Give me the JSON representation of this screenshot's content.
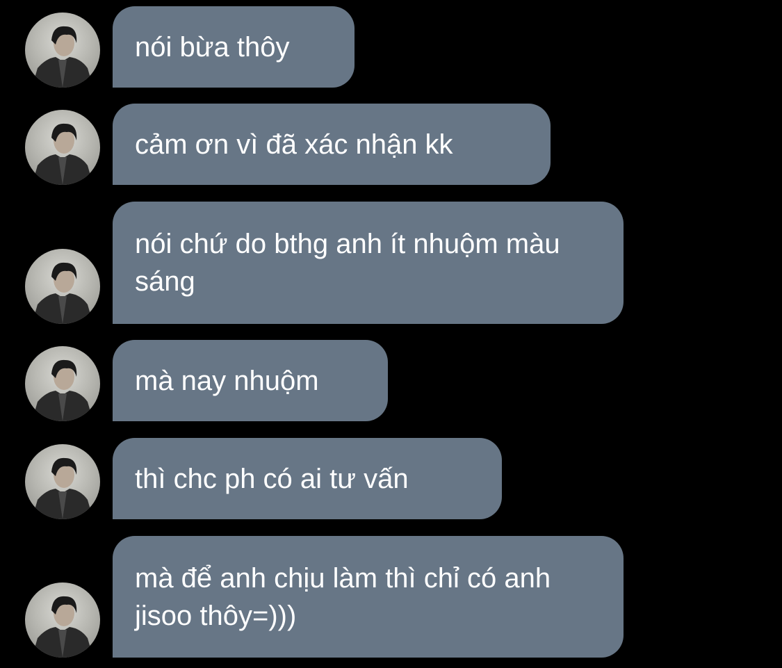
{
  "chat": {
    "messages": [
      {
        "text": "nói bừa thôy"
      },
      {
        "text": "cảm ơn vì đã xác nhận kk"
      },
      {
        "text": "nói chứ do bthg anh ít nhuộm màu sáng"
      },
      {
        "text": "mà nay nhuộm"
      },
      {
        "text": "thì chc ph có ai tư vấn"
      },
      {
        "text": "mà để anh chịu làm thì chỉ có anh jisoo thôy=)))"
      }
    ],
    "bubble_color": "#677686",
    "background_color": "#000000",
    "avatar_icon": "profile-photo"
  }
}
